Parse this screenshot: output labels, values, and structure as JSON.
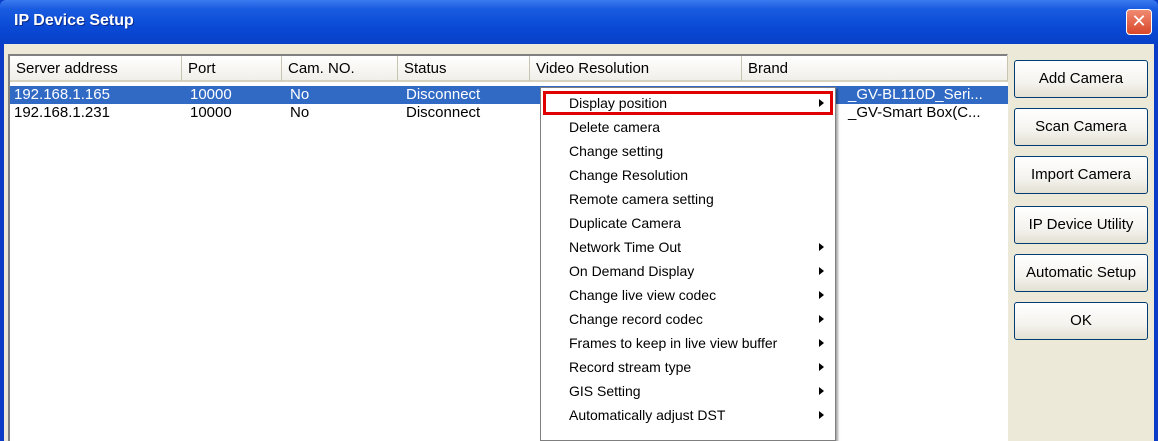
{
  "window": {
    "title": "IP Device Setup",
    "close_glyph": "✕"
  },
  "table": {
    "columns": [
      "Server address",
      "Port",
      "Cam. NO.",
      "Status",
      "Video Resolution",
      "Brand"
    ],
    "rows": [
      {
        "server": "192.168.1.165",
        "port": "10000",
        "cam": "No",
        "status": "Disconnect",
        "brand": "_GV-BL110D_Seri...",
        "selected": true
      },
      {
        "server": "192.168.1.231",
        "port": "10000",
        "cam": "No",
        "status": "Disconnect",
        "brand": "_GV-Smart Box(C...",
        "selected": false
      }
    ]
  },
  "buttons": {
    "add": "Add Camera",
    "scan": "Scan Camera",
    "import": "Import Camera",
    "utility": "IP Device Utility",
    "auto": "Automatic Setup",
    "ok": "OK"
  },
  "menu": {
    "items": [
      {
        "label": "Display position",
        "submenu": true,
        "highlighted": true
      },
      {
        "label": "Delete camera",
        "submenu": false
      },
      {
        "label": "Change setting",
        "submenu": false
      },
      {
        "label": "Change Resolution",
        "submenu": false
      },
      {
        "label": "Remote camera setting",
        "submenu": false
      },
      {
        "label": "Duplicate Camera",
        "submenu": false
      },
      {
        "label": "Network Time Out",
        "submenu": true
      },
      {
        "label": "On Demand Display",
        "submenu": true
      },
      {
        "label": "Change live view codec",
        "submenu": true
      },
      {
        "label": "Change record codec",
        "submenu": true
      },
      {
        "label": "Frames to keep in live view buffer",
        "submenu": true
      },
      {
        "label": "Record stream type",
        "submenu": true
      },
      {
        "label": "GIS Setting",
        "submenu": true
      },
      {
        "label": "Automatically adjust DST",
        "submenu": true
      }
    ]
  },
  "colors": {
    "selection": "#316ac5",
    "highlight_box": "#e00000",
    "titlebar": "#0a4ad6"
  }
}
